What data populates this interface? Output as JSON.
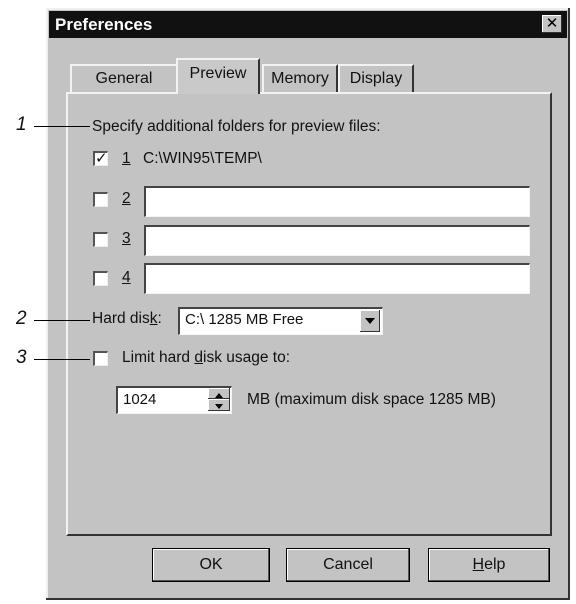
{
  "window": {
    "title": "Preferences",
    "close_glyph": "✕"
  },
  "tabs": [
    {
      "label": "General",
      "active": false
    },
    {
      "label": "Preview",
      "active": true
    },
    {
      "label": "Memory",
      "active": false
    },
    {
      "label": "Display",
      "active": false
    }
  ],
  "preview": {
    "folders_label": "Specify additional folders for preview files:",
    "folders": [
      {
        "num": "1",
        "checked": true,
        "value": "C:\\WIN95\\TEMP\\"
      },
      {
        "num": "2",
        "checked": false,
        "value": ""
      },
      {
        "num": "3",
        "checked": false,
        "value": ""
      },
      {
        "num": "4",
        "checked": false,
        "value": ""
      }
    ],
    "hard_disk_label_pre": "Hard dis",
    "hard_disk_label_key": "k",
    "hard_disk_label_post": ":",
    "hard_disk_value": "C:\\ 1285 MB Free",
    "limit_label_pre": "Limit hard ",
    "limit_label_key": "d",
    "limit_label_post": "isk usage to:",
    "limit_checked": false,
    "limit_value": "1024",
    "limit_unit": "MB (maximum disk space 1285 MB)"
  },
  "buttons": {
    "ok": "OK",
    "cancel": "Cancel",
    "help_key": "H",
    "help_rest": "elp"
  },
  "callouts": [
    "1",
    "2",
    "3"
  ],
  "colors": {
    "titlebar": "#111111",
    "face": "#c3c3c3"
  }
}
